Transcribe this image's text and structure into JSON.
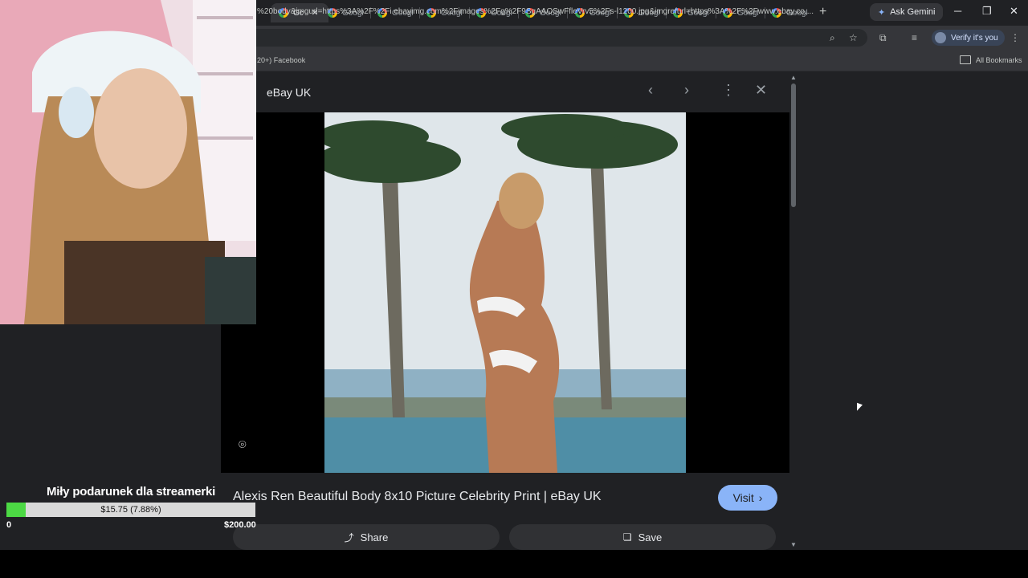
{
  "tabs": [
    {
      "label": "Gc",
      "active": true
    },
    {
      "label": "Googl"
    },
    {
      "label": "Googl"
    },
    {
      "label": "Googl"
    },
    {
      "label": "Googl"
    },
    {
      "label": "Googl"
    },
    {
      "label": "Googl"
    },
    {
      "label": "Googl"
    },
    {
      "label": "Googl"
    },
    {
      "label": "Googl"
    },
    {
      "label": "Googl"
    }
  ],
  "toolbar": {
    "ask_gemini": "Ask Gemini",
    "url": "%20body&imgurl=https%3A%2F%2Fi.ebayimg.com%2Fimages%2Fg%2F9SgAAOSwFfleVrv5%2Fs-l1200.jpg&imgrefurl=https%3A%2F%2Fwww.ebay.co....",
    "verify": "Verify it's you"
  },
  "bookmarks": {
    "partial_item": "20+) Facebook",
    "all_bookmarks": "All Bookmarks"
  },
  "panel": {
    "source": "eBay UK",
    "caption": "Alexis Ren Beautiful Body 8x10 Picture Celebrity Print | eBay UK",
    "visit_label": "Visit",
    "share_label": "Share",
    "save_label": "Save"
  },
  "donation_goal": {
    "title": "Miły podarunek dla streamerki",
    "progress_label": "$15.75 (7.88%)",
    "progress_fraction": 0.0788,
    "min_label": "0",
    "max_label": "$200.00"
  },
  "colors": {
    "accent": "#8ab4f8",
    "goal_fill": "#4cd944",
    "chrome_bg": "#202124"
  }
}
